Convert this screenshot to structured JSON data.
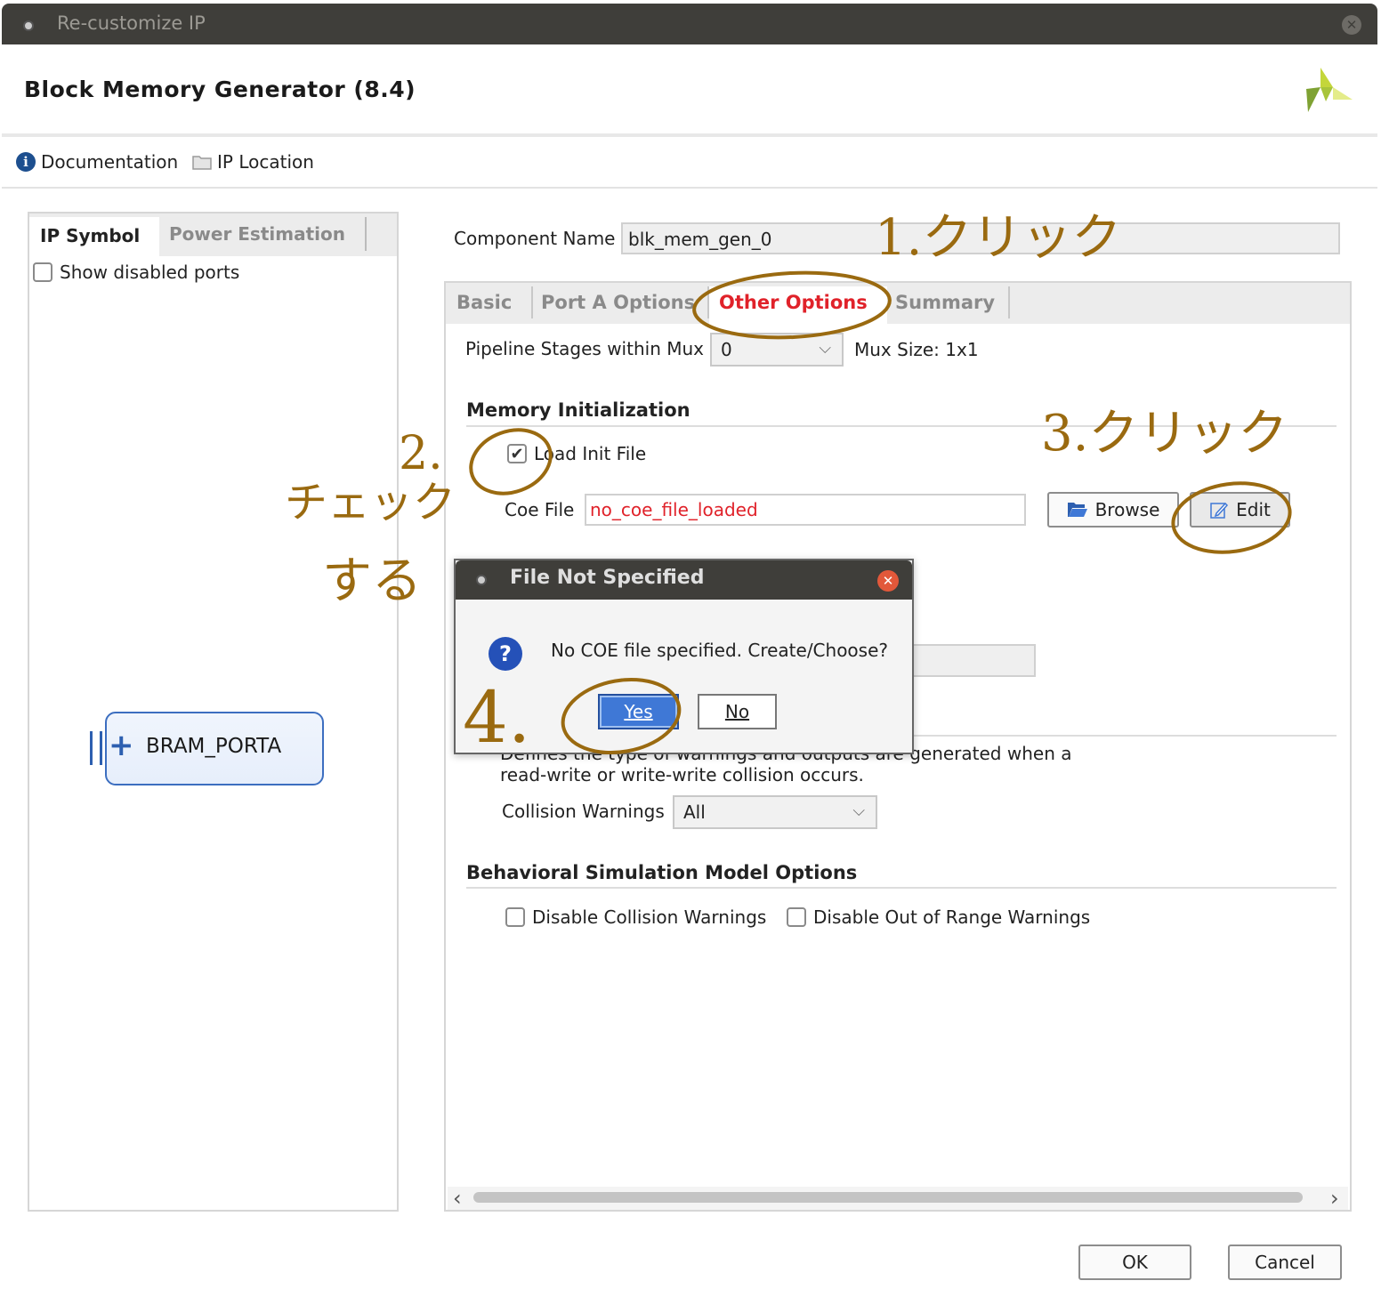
{
  "window": {
    "title": "Re-customize IP",
    "close_glyph": "✕"
  },
  "header": {
    "app_title": "Block Memory Generator (8.4)",
    "logo_icon": "xilinx-logo"
  },
  "linkbar": {
    "documentation": "Documentation",
    "ip_location": "IP Location"
  },
  "left_panel": {
    "tabs": [
      "IP Symbol",
      "Power Estimation"
    ],
    "active_tab": "IP Symbol",
    "show_disabled_ports_label": "Show disabled ports",
    "show_disabled_ports_checked": false,
    "symbol": {
      "plus_glyph": "+",
      "port_label": "BRAM_PORTA"
    }
  },
  "right_panel": {
    "component_name_label": "Component Name",
    "component_name_value": "blk_mem_gen_0",
    "tabs": [
      "Basic",
      "Port A Options",
      "Other Options",
      "Summary"
    ],
    "active_tab": "Other Options",
    "pipeline_label": "Pipeline Stages within Mux",
    "pipeline_value": "0",
    "mux_size": "Mux Size: 1x1",
    "memory_init_heading": "Memory Initialization",
    "load_init_label": "Load Init File",
    "load_init_checked": true,
    "coe_label": "Coe File",
    "coe_value": "no_coe_file_loaded",
    "browse_label": "Browse",
    "edit_label": "Edit",
    "collision_desc_line1": "Defines the type of warnings and outputs are generated when a",
    "collision_desc_line2": "read-write or write-write collision occurs.",
    "collision_warnings_label": "Collision Warnings",
    "collision_warnings_value": "All",
    "bsm_heading": "Behavioral Simulation Model Options",
    "disable_collision_label": "Disable Collision Warnings",
    "disable_range_label": "Disable Out of Range Warnings",
    "scroll_left_glyph": "‹",
    "scroll_right_glyph": "›"
  },
  "footer": {
    "ok_label": "OK",
    "cancel_label": "Cancel"
  },
  "dialog": {
    "title": "File Not Specified",
    "close_glyph": "✕",
    "icon_glyph": "?",
    "message": "No COE file specified. Create/Choose?",
    "yes_label": "Yes",
    "no_label": "No"
  },
  "annotations": {
    "step1": "1.クリック",
    "step2_num": "2.",
    "step2_text1": "チェック",
    "step2_text2": "する",
    "step3": "3.クリック",
    "step4": "4."
  },
  "colors": {
    "titlebar": "#3f3e3a",
    "accent_red": "#e0222a",
    "yes_button": "#3f78d6",
    "annotation": "#9a6a10"
  }
}
